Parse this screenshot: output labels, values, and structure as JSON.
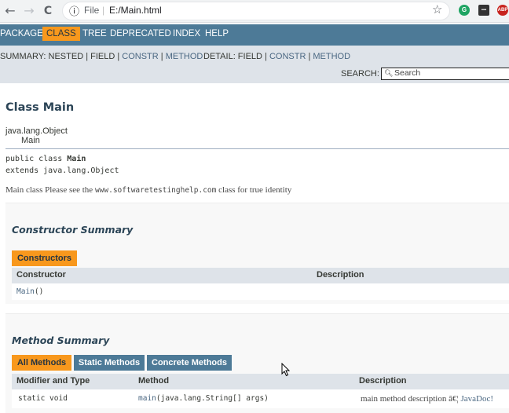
{
  "browser": {
    "back_glyph": "←",
    "forward_glyph": "→",
    "reload_glyph": "C",
    "info_glyph": "ⓘ",
    "file_label": "File",
    "separator": "|",
    "url": "E:/Main.html",
    "star_glyph": "☆",
    "ext1": "G",
    "ext2": "▪▪▪",
    "ext3": "ABP"
  },
  "nav": {
    "items": [
      "PACKAGE",
      "CLASS",
      "TREE",
      "DEPRECATED",
      "INDEX",
      "HELP"
    ],
    "active": "CLASS"
  },
  "subnav": {
    "summary_label": "SUMMARY: NESTED | FIELD | ",
    "summary_constr": "CONSTR",
    "summary_sep": " | ",
    "summary_method": "METHOD",
    "detail_label": "DETAIL: FIELD | ",
    "detail_constr": "CONSTR",
    "detail_sep": " | ",
    "detail_method": "METHOD",
    "search_label": "SEARCH:",
    "search_placeholder": "Search"
  },
  "class_info": {
    "title": "Class Main",
    "hierarchy_parent": "java.lang.Object",
    "hierarchy_child": "Main",
    "signature_line1_prefix": "public class ",
    "signature_line1_name": "Main",
    "signature_line2": "extends java.lang.Object",
    "description_prefix": "Main class Please see the ",
    "description_url": "www.softwaretestinghelp.com",
    "description_suffix": " class for true identity"
  },
  "constructor_summary": {
    "title": "Constructor Summary",
    "tab": "Constructors",
    "columns": [
      "Constructor",
      "Description"
    ],
    "rows": [
      {
        "name": "Main",
        "params": "()",
        "description": ""
      }
    ]
  },
  "method_summary": {
    "title": "Method Summary",
    "tabs": [
      "All Methods",
      "Static Methods",
      "Concrete Methods"
    ],
    "active_tab": "All Methods",
    "columns": [
      "Modifier and Type",
      "Method",
      "Description"
    ],
    "rows": [
      {
        "modifier": "static void",
        "name": "main",
        "params": "(java.lang.String[] args)",
        "description_prefix": "main method description â€¦ ",
        "description_link": "JavaDoc!"
      }
    ]
  },
  "colors": {
    "nav_bg": "#4d7a97",
    "active_tab": "#f8981d",
    "subnav_bg": "#dee3e9",
    "link": "#4a6782"
  }
}
